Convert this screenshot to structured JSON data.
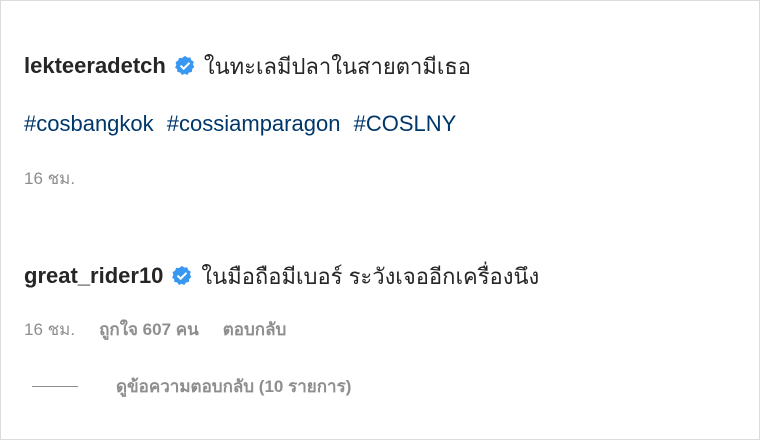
{
  "post": {
    "username": "lekteeradetch",
    "caption_text": "ในทะเลมีปลาในสายตามีเธอ",
    "hashtags": [
      "#cosbangkok",
      "#cossiamparagon",
      "#COSLNY"
    ],
    "time": "16 ชม."
  },
  "comment": {
    "username": "great_rider10",
    "text": "ในมือถือมีเบอร์ ระวังเจออีกเครื่องนึง",
    "time": "16 ชม.",
    "likes": "ถูกใจ 607 คน",
    "reply_label": "ตอบกลับ",
    "view_replies_label": "ดูข้อความตอบกลับ (10 รายการ)"
  },
  "colors": {
    "verified_badge": "#3897f0",
    "hashtag": "#00376b",
    "secondary_text": "#8e8e8e",
    "primary_text": "#262626"
  },
  "icons": {
    "verified": "verified-badge-icon"
  }
}
